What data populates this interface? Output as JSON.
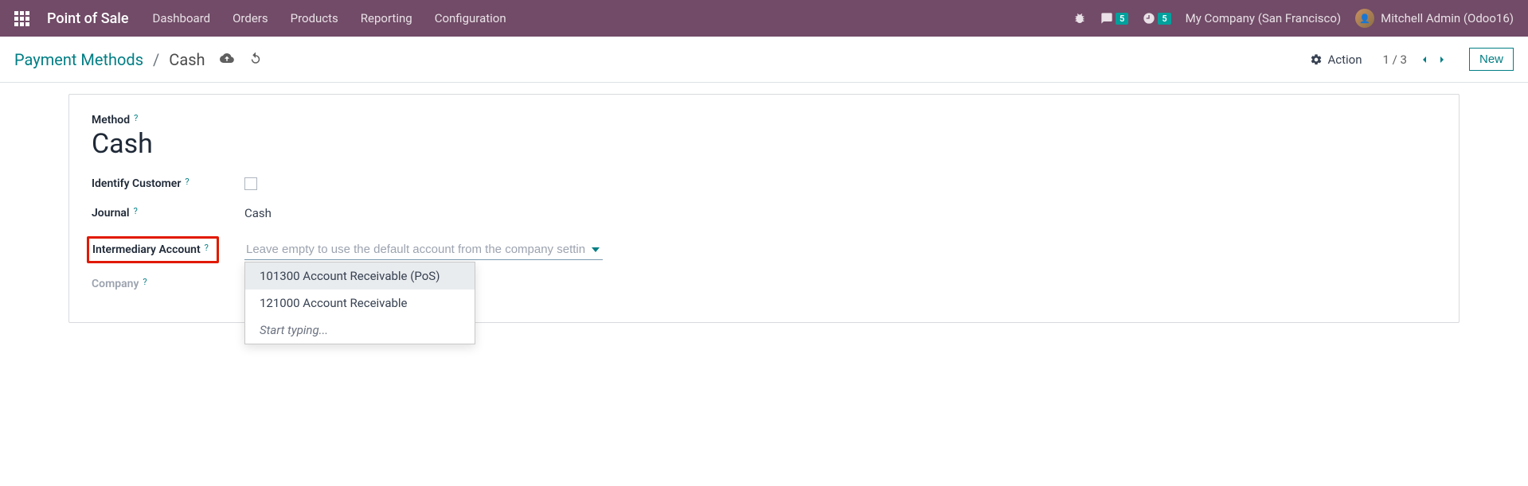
{
  "topbar": {
    "app_title": "Point of Sale",
    "nav": [
      "Dashboard",
      "Orders",
      "Products",
      "Reporting",
      "Configuration"
    ],
    "messages_badge": "5",
    "activities_badge": "5",
    "company": "My Company (San Francisco)",
    "user": "Mitchell Admin (Odoo16)"
  },
  "subbar": {
    "breadcrumb_root": "Payment Methods",
    "breadcrumb_current": "Cash",
    "action_label": "Action",
    "pager": "1 / 3",
    "new_btn": "New"
  },
  "form": {
    "method_label": "Method",
    "method_value": "Cash",
    "identify_label": "Identify Customer",
    "journal_label": "Journal",
    "journal_value": "Cash",
    "intermediary_label": "Intermediary Account",
    "intermediary_placeholder": "Leave empty to use the default account from the company settings",
    "company_label": "Company"
  },
  "dropdown": {
    "items": [
      "101300 Account Receivable (PoS)",
      "121000 Account Receivable"
    ],
    "typing": "Start typing..."
  }
}
